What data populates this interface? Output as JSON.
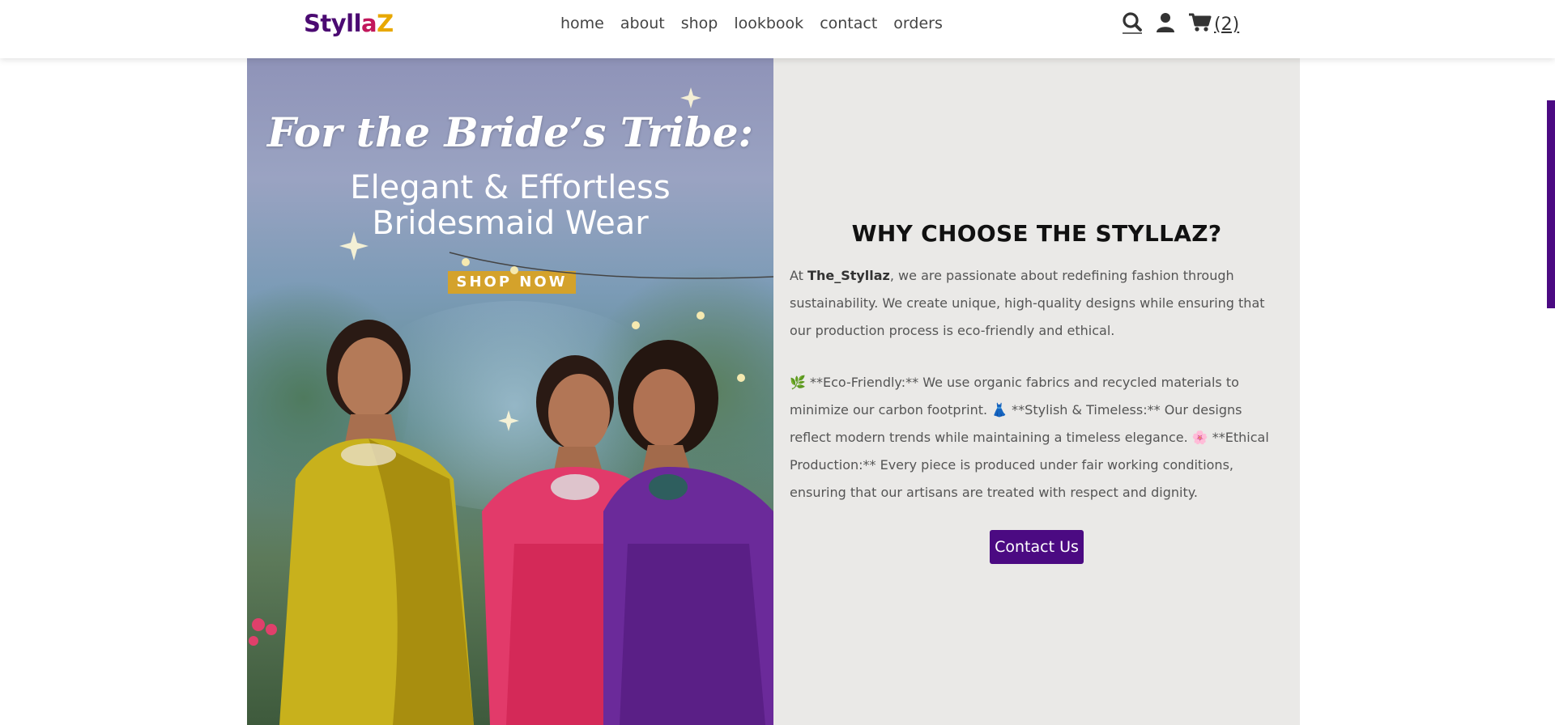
{
  "header": {
    "logo": {
      "part1": "Styll",
      "part2": "a",
      "part3": "Z"
    },
    "nav": [
      "home",
      "about",
      "shop",
      "lookbook",
      "contact",
      "orders"
    ],
    "cart_count": "(2)"
  },
  "hero": {
    "headline": "For the Bride’s Tribe:",
    "subline1": "Elegant & Effortless",
    "subline2": "Bridesmaid Wear",
    "cta": "SHOP NOW"
  },
  "about_panel": {
    "title": "WHY CHOOSE THE STYLLAZ?",
    "intro_prefix": "At ",
    "brand": "The_Styllaz",
    "intro_suffix": ", we are passionate about redefining fashion through sustainability. We create unique, high-quality designs while ensuring that our production process is eco-friendly and ethical.",
    "features": "🌿 **Eco-Friendly:** We use organic fabrics and recycled materials to minimize our carbon footprint. 👗 **Stylish & Timeless:** Our designs reflect modern trends while maintaining a timeless elegance. 🌸 **Ethical Production:** Every piece is produced under fair working conditions, ensuring that our artisans are treated with respect and dignity.",
    "button": "Contact Us"
  },
  "colors": {
    "brand_purple": "#4b0a82",
    "logo_pink": "#c2185b",
    "logo_gold": "#e8a800",
    "panel_bg": "#eae9e7",
    "cta_gold": "#d4a22b"
  },
  "icons": [
    "search-icon",
    "user-icon",
    "cart-icon"
  ]
}
